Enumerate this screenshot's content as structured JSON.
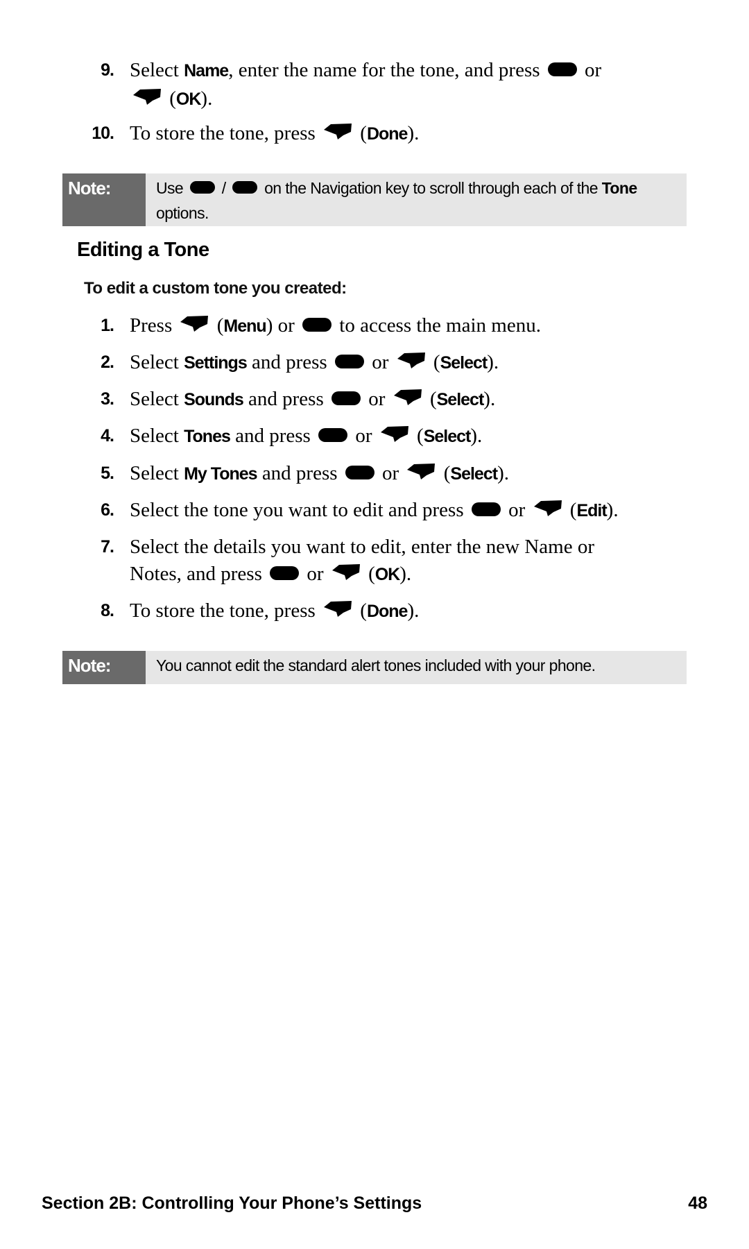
{
  "top_steps": [
    {
      "num": "9.",
      "segments": [
        {
          "t": "Select "
        },
        {
          "t": "Name",
          "b": true
        },
        {
          "t": ", enter the name for the tone, and press "
        },
        {
          "icon": "menu-ok-key"
        },
        {
          "t": " or "
        },
        {
          "br": true
        },
        {
          "icon": "soft-key"
        },
        {
          "t": " ("
        },
        {
          "t": "OK",
          "b": true
        },
        {
          "t": ")."
        }
      ]
    },
    {
      "num": "10.",
      "segments": [
        {
          "t": "To store the tone, press "
        },
        {
          "icon": "soft-key"
        },
        {
          "t": " ("
        },
        {
          "t": "Done",
          "b": true
        },
        {
          "t": ")."
        }
      ]
    }
  ],
  "note1": {
    "label": "Note:",
    "segments": [
      {
        "t": "Use "
      },
      {
        "icon": "nav-key"
      },
      {
        "t": " / "
      },
      {
        "icon": "nav-key"
      },
      {
        "t": " on the Navigation key to scroll through each of the "
      },
      {
        "t": "Tone",
        "b": true
      },
      {
        "t": " options."
      }
    ]
  },
  "section": {
    "title": "Editing a Tone",
    "subtitle": "To edit a custom tone you created:"
  },
  "steps": [
    {
      "num": "1.",
      "segments": [
        {
          "t": "Press "
        },
        {
          "icon": "soft-key"
        },
        {
          "t": " ("
        },
        {
          "t": "Menu",
          "b": true
        },
        {
          "t": ") or "
        },
        {
          "icon": "menu-ok-key"
        },
        {
          "t": " to access the main menu."
        }
      ]
    },
    {
      "num": "2.",
      "segments": [
        {
          "t": "Select "
        },
        {
          "t": "Settings",
          "b": true
        },
        {
          "t": " and press "
        },
        {
          "icon": "menu-ok-key"
        },
        {
          "t": " or "
        },
        {
          "icon": "soft-key"
        },
        {
          "t": " ("
        },
        {
          "t": "Select",
          "b": true
        },
        {
          "t": ")."
        }
      ]
    },
    {
      "num": "3.",
      "segments": [
        {
          "t": "Select "
        },
        {
          "t": "Sounds",
          "b": true
        },
        {
          "t": " and press "
        },
        {
          "icon": "menu-ok-key"
        },
        {
          "t": " or "
        },
        {
          "icon": "soft-key"
        },
        {
          "t": " ("
        },
        {
          "t": "Select",
          "b": true
        },
        {
          "t": ")."
        }
      ]
    },
    {
      "num": "4.",
      "segments": [
        {
          "t": "Select "
        },
        {
          "t": "Tones",
          "b": true
        },
        {
          "t": " and press "
        },
        {
          "icon": "menu-ok-key"
        },
        {
          "t": " or "
        },
        {
          "icon": "soft-key"
        },
        {
          "t": " ("
        },
        {
          "t": "Select",
          "b": true
        },
        {
          "t": ")."
        }
      ]
    },
    {
      "num": "5.",
      "segments": [
        {
          "t": "Select "
        },
        {
          "t": "My Tones",
          "b": true
        },
        {
          "t": " and press "
        },
        {
          "icon": "menu-ok-key"
        },
        {
          "t": " or "
        },
        {
          "icon": "soft-key"
        },
        {
          "t": " ("
        },
        {
          "t": "Select",
          "b": true
        },
        {
          "t": ")."
        }
      ]
    },
    {
      "num": "6.",
      "segments": [
        {
          "t": "Select the tone you want to edit and press "
        },
        {
          "icon": "menu-ok-key"
        },
        {
          "t": " or "
        },
        {
          "icon": "soft-key"
        },
        {
          "t": " ("
        },
        {
          "t": "Edit",
          "b": true
        },
        {
          "t": ")."
        }
      ]
    },
    {
      "num": "7.",
      "segments": [
        {
          "t": "Select the details you want to edit, enter the new Name or "
        },
        {
          "br": true
        },
        {
          "t": "Notes, and press "
        },
        {
          "icon": "menu-ok-key"
        },
        {
          "t": " or "
        },
        {
          "icon": "soft-key"
        },
        {
          "t": " ("
        },
        {
          "t": "OK",
          "b": true
        },
        {
          "t": ")."
        }
      ]
    },
    {
      "num": "8.",
      "segments": [
        {
          "t": "To store the tone, press "
        },
        {
          "icon": "soft-key"
        },
        {
          "t": " ("
        },
        {
          "t": "Done",
          "b": true
        },
        {
          "t": ")."
        }
      ]
    }
  ],
  "note2": {
    "label": "Note:",
    "segments": [
      {
        "t": "You cannot edit the standard alert tones included with your phone."
      }
    ]
  },
  "footer": {
    "section": "Section 2B: Controlling Your Phone’s Settings",
    "page": "48"
  }
}
